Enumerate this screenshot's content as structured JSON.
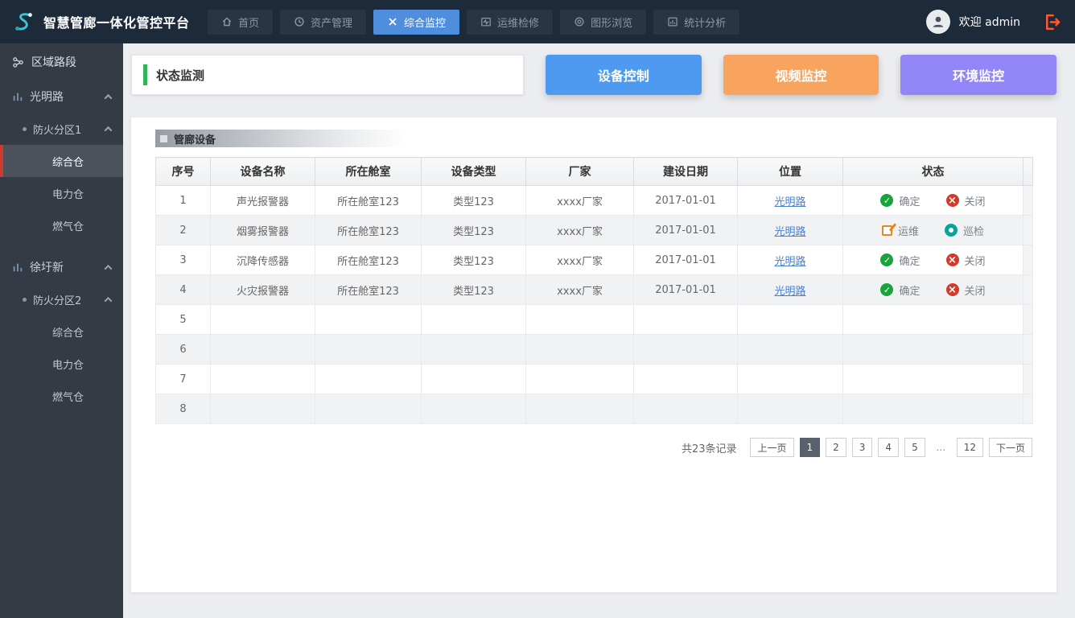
{
  "topbar": {
    "title": "智慧管廊一体化管控平台",
    "nav": [
      {
        "label": "首页",
        "icon": "home-icon",
        "active": false
      },
      {
        "label": "资产管理",
        "icon": "asset-icon",
        "active": false
      },
      {
        "label": "综合监控",
        "icon": "monitor-icon",
        "active": true
      },
      {
        "label": "运维检修",
        "icon": "maintenance-icon",
        "active": false
      },
      {
        "label": "图形浏览",
        "icon": "graphics-icon",
        "active": false
      },
      {
        "label": "统计分析",
        "icon": "stats-icon",
        "active": false
      }
    ],
    "welcome": "欢迎 admin",
    "active_color": "#4e8edd"
  },
  "sidebar": {
    "title": "区域路段",
    "groups": [
      {
        "label": "光明路",
        "section": "防火分区1",
        "items": [
          "综合仓",
          "电力仓",
          "燃气仓"
        ],
        "selected_item": "综合仓"
      },
      {
        "label": "徐圩新",
        "section": "防火分区2",
        "items": [
          "综合仓",
          "电力仓",
          "燃气仓"
        ],
        "selected_item": ""
      }
    ],
    "selected_accent": "#cf3b2d"
  },
  "toolbar": {
    "status_label": "状态监测",
    "status_accent_color": "#2fb457",
    "buttons": [
      {
        "label": "设备控制",
        "color": "#4d9af0"
      },
      {
        "label": "视频监控",
        "color": "#f8a45f"
      },
      {
        "label": "环境监控",
        "color": "#9285f7"
      }
    ]
  },
  "panel": {
    "title": "管廊设备",
    "table": {
      "headers": [
        "序号",
        "设备名称",
        "所在舱室",
        "设备类型",
        "厂家",
        "建设日期",
        "位置",
        "状态"
      ],
      "link_color": "#4a7fd0",
      "status_colors": {
        "ok": "#18a33d",
        "closed": "#d43a2a",
        "maintain": "#e8851e",
        "inspect": "#0aa39b"
      },
      "rows": [
        {
          "no": "1",
          "name": "声光报警器",
          "room": "所在舱室123",
          "type": "类型123",
          "vendor": "xxxx厂家",
          "date": "2017-01-01",
          "location": "光明路",
          "status": [
            {
              "type": "ok",
              "label": "确定"
            },
            {
              "type": "closed",
              "label": "关闭"
            }
          ]
        },
        {
          "no": "2",
          "name": "烟雾报警器",
          "room": "所在舱室123",
          "type": "类型123",
          "vendor": "xxxx厂家",
          "date": "2017-01-01",
          "location": "光明路",
          "status": [
            {
              "type": "maintain",
              "label": "运维"
            },
            {
              "type": "inspect",
              "label": "巡检"
            }
          ]
        },
        {
          "no": "3",
          "name": "沉降传感器",
          "room": "所在舱室123",
          "type": "类型123",
          "vendor": "xxxx厂家",
          "date": "2017-01-01",
          "location": "光明路",
          "status": [
            {
              "type": "ok",
              "label": "确定"
            },
            {
              "type": "closed",
              "label": "关闭"
            }
          ]
        },
        {
          "no": "4",
          "name": "火灾报警器",
          "room": "所在舱室123",
          "type": "类型123",
          "vendor": "xxxx厂家",
          "date": "2017-01-01",
          "location": "光明路",
          "status": [
            {
              "type": "ok",
              "label": "确定"
            },
            {
              "type": "closed",
              "label": "关闭"
            }
          ]
        },
        {
          "no": "5"
        },
        {
          "no": "6"
        },
        {
          "no": "7"
        },
        {
          "no": "8"
        }
      ]
    },
    "pagination": {
      "total_label": "共23条记录",
      "prev_label": "上一页",
      "next_label": "下一页",
      "pages": [
        "1",
        "2",
        "3",
        "4",
        "5",
        "…",
        "12"
      ],
      "active_page": "1"
    }
  }
}
